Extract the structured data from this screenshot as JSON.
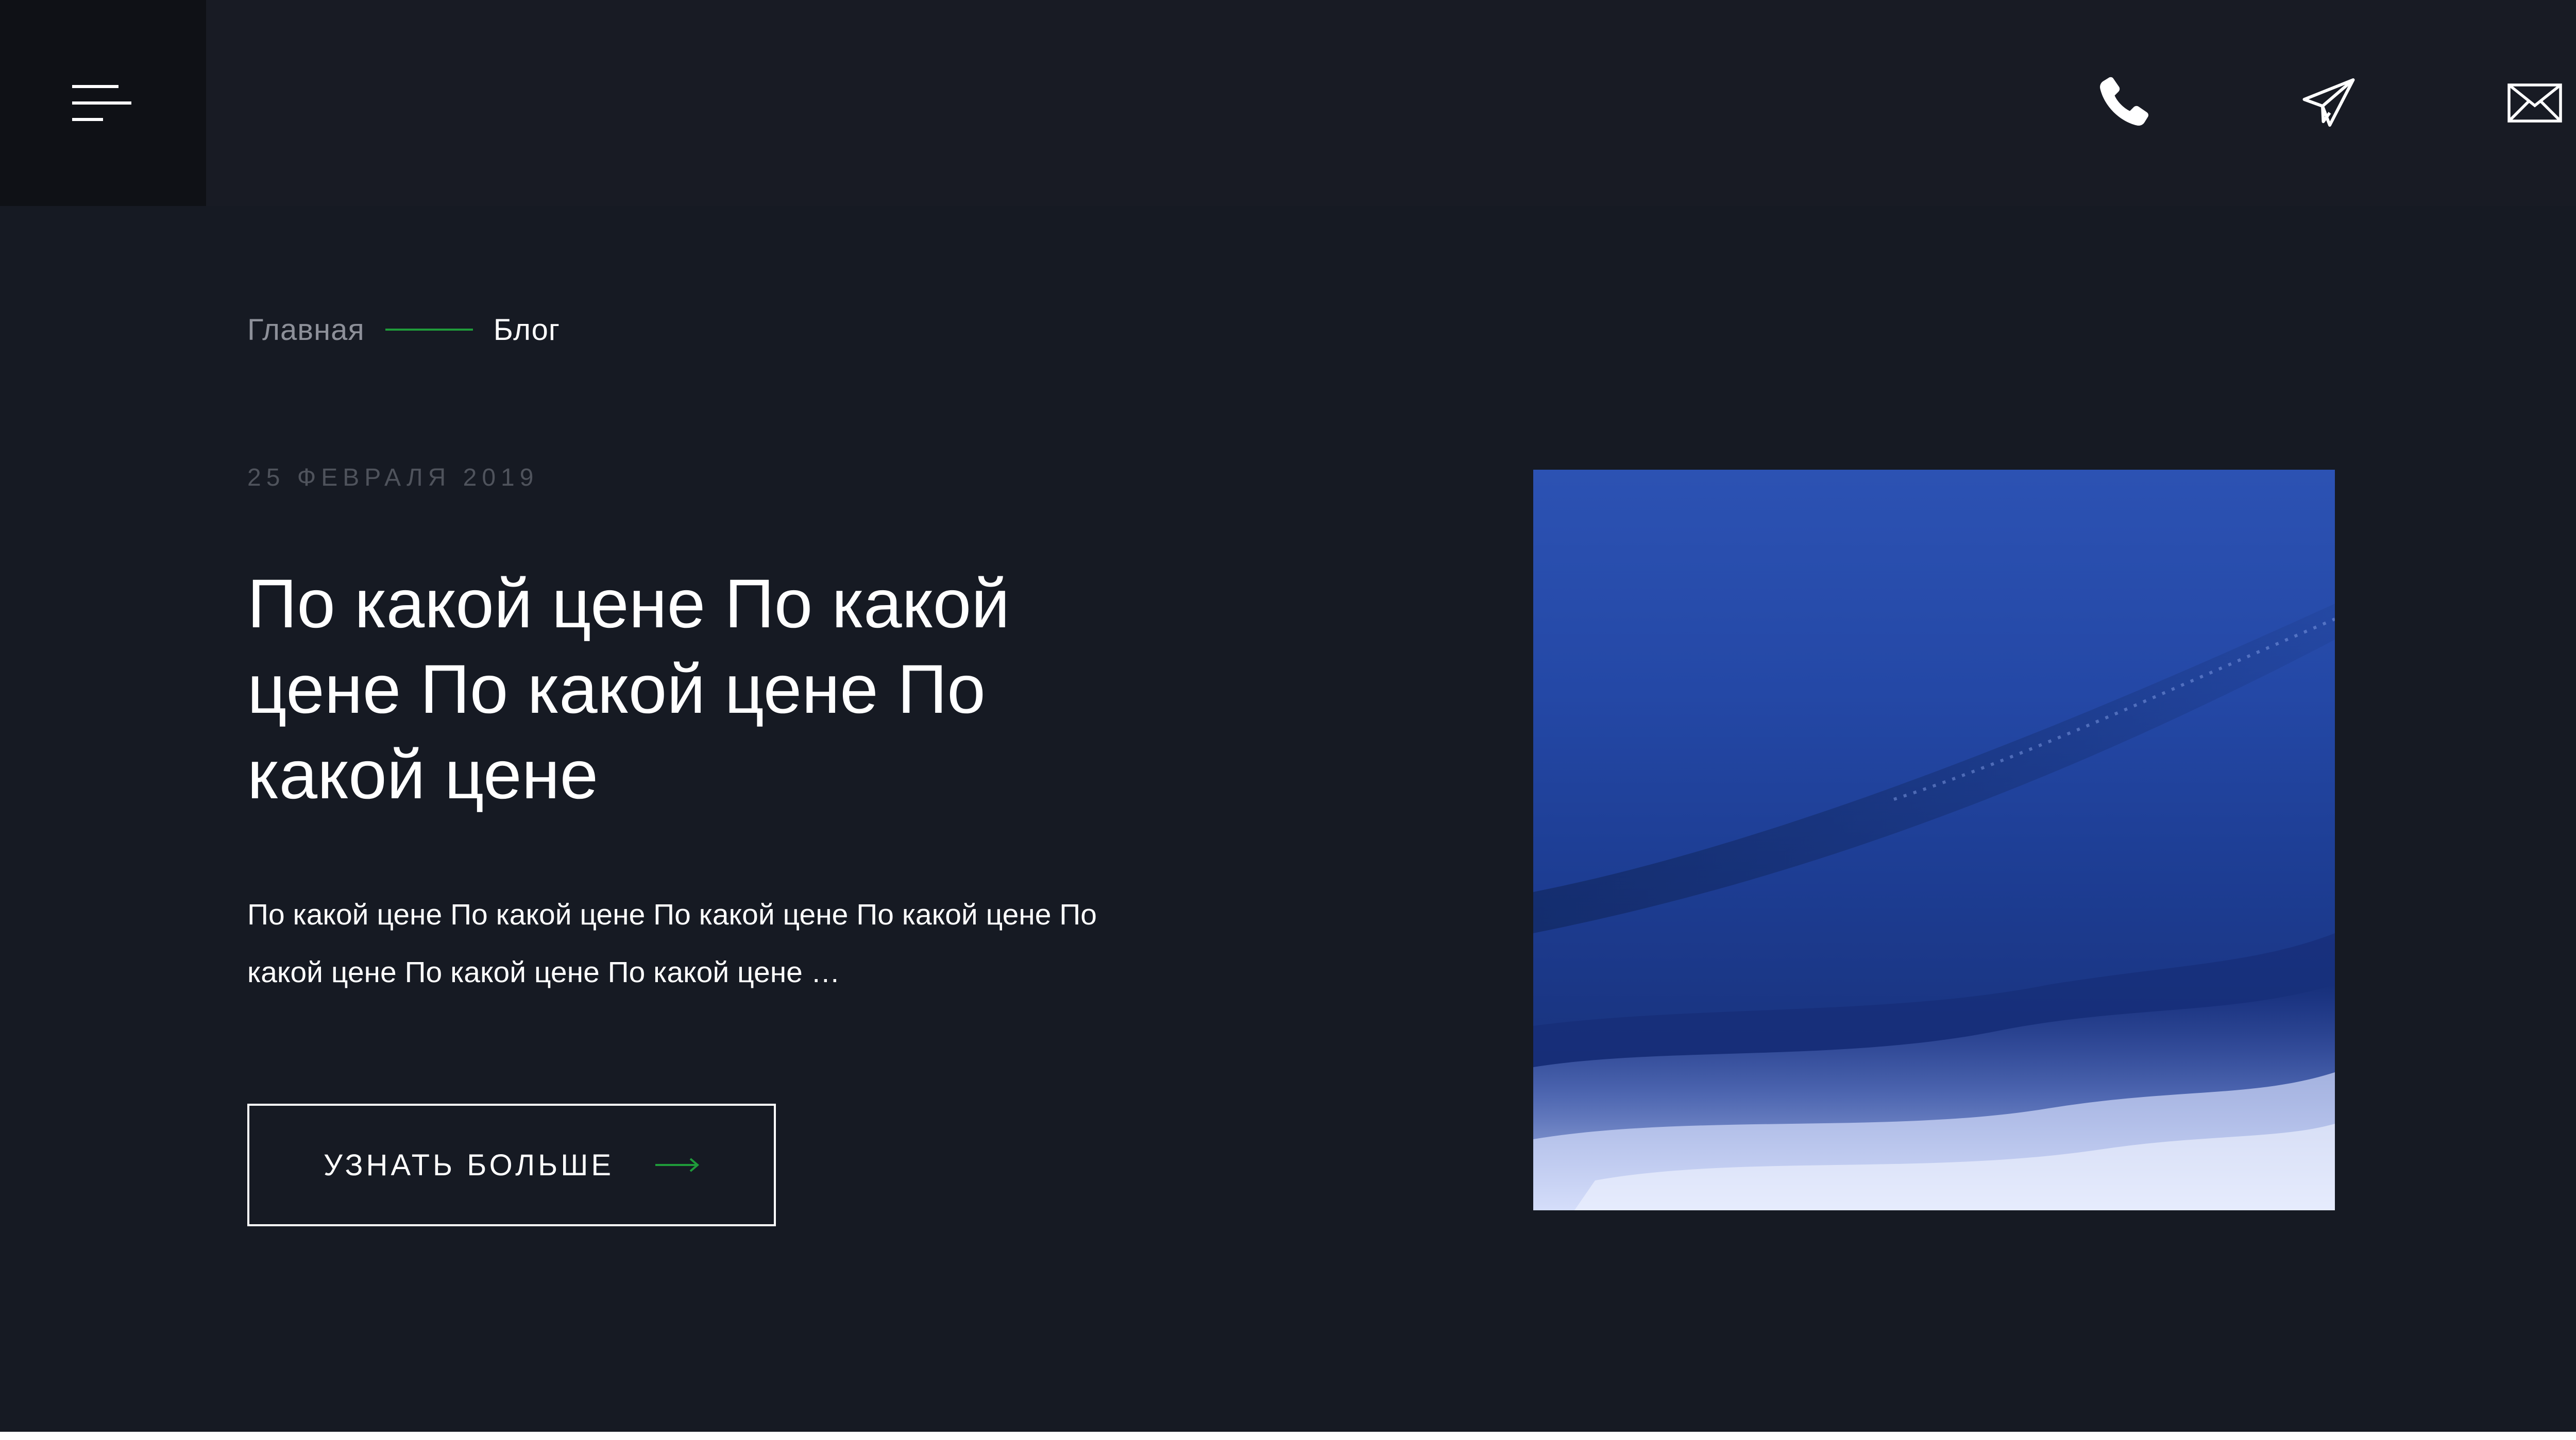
{
  "header": {
    "menu_icon": "hamburger-menu-icon",
    "contacts": [
      {
        "icon": "phone-icon"
      },
      {
        "icon": "telegram-icon"
      },
      {
        "icon": "mail-icon"
      }
    ]
  },
  "breadcrumb": {
    "home": "Главная",
    "current": "Блог"
  },
  "post": {
    "date": "25 ФЕВРАЛЯ 2019",
    "title": "По какой цене По какой цене По какой цене По какой цене",
    "excerpt": "По какой цене По какой цене По какой цене По какой цене По какой цене По какой цене По какой цене …",
    "button_label": "УЗНАТЬ БОЛЬШЕ",
    "image": "ocean-wave-photo"
  },
  "colors": {
    "background": "#161a23",
    "header": "#181b24",
    "menu_box": "#0f1116",
    "accent": "#1f9b3a",
    "text": "#ffffff",
    "muted": "#8d9099"
  }
}
